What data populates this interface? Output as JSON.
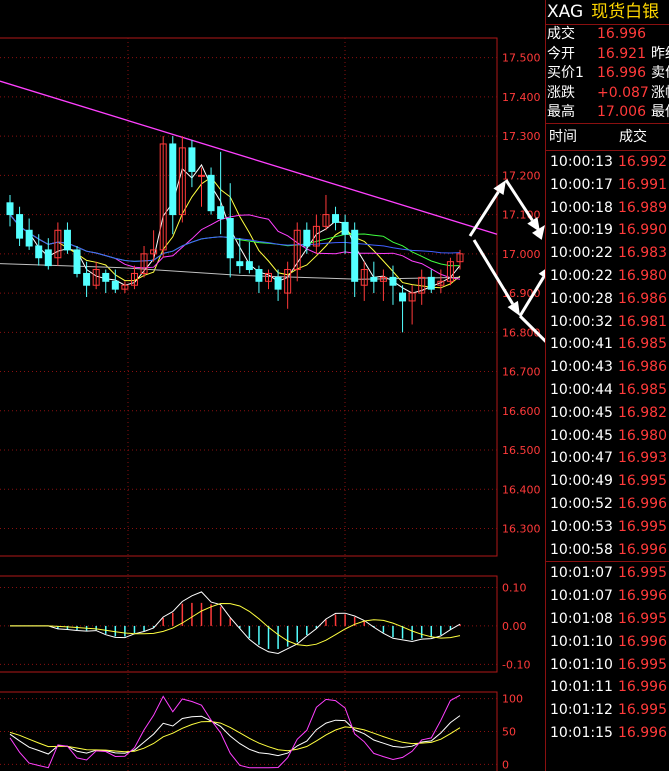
{
  "header": {
    "symbol": "XAG",
    "name": "现货白银"
  },
  "quotes": [
    {
      "label": "成交",
      "value": "16.996",
      "extra": ""
    },
    {
      "label": "今开",
      "value": "16.921",
      "extra": "昨结"
    },
    {
      "label": "买价1",
      "value": "16.996",
      "extra": "卖价"
    },
    {
      "label": "涨跌",
      "value": "+0.087",
      "extra": "涨幅"
    },
    {
      "label": "最高",
      "value": "17.006",
      "extra": "最低"
    }
  ],
  "trades_header": {
    "time": "时间",
    "price": "成交"
  },
  "trades": [
    {
      "time": "10:00:13",
      "price": "16.992"
    },
    {
      "time": "10:00:17",
      "price": "16.991"
    },
    {
      "time": "10:00:18",
      "price": "16.989"
    },
    {
      "time": "10:00:19",
      "price": "16.990"
    },
    {
      "time": "10:00:22",
      "price": "16.983"
    },
    {
      "time": "10:00:22",
      "price": "16.980"
    },
    {
      "time": "10:00:28",
      "price": "16.986"
    },
    {
      "time": "10:00:32",
      "price": "16.981"
    },
    {
      "time": "10:00:41",
      "price": "16.985"
    },
    {
      "time": "10:00:43",
      "price": "16.986"
    },
    {
      "time": "10:00:44",
      "price": "16.985"
    },
    {
      "time": "10:00:45",
      "price": "16.982"
    },
    {
      "time": "10:00:45",
      "price": "16.980"
    },
    {
      "time": "10:00:47",
      "price": "16.993"
    },
    {
      "time": "10:00:49",
      "price": "16.995"
    },
    {
      "time": "10:00:52",
      "price": "16.996"
    },
    {
      "time": "10:00:53",
      "price": "16.995"
    },
    {
      "time": "10:00:58",
      "price": "16.996"
    },
    {
      "time": "10:01:07",
      "price": "16.995"
    },
    {
      "time": "10:01:07",
      "price": "16.996"
    },
    {
      "time": "10:01:08",
      "price": "16.995"
    },
    {
      "time": "10:01:10",
      "price": "16.996"
    },
    {
      "time": "10:01:10",
      "price": "16.995"
    },
    {
      "time": "10:01:11",
      "price": "16.996"
    },
    {
      "time": "10:01:12",
      "price": "16.995"
    },
    {
      "time": "10:01:15",
      "price": "16.996"
    }
  ],
  "chart_data": {
    "type": "candlestick",
    "price_axis": {
      "ticks": [
        "17.500",
        "17.400",
        "17.300",
        "17.200",
        "17.100",
        "17.000",
        "16.900",
        "16.800",
        "16.700",
        "16.600",
        "16.500",
        "16.400",
        "16.300"
      ],
      "range": [
        16.23,
        17.55
      ]
    },
    "macd_axis": {
      "ticks": [
        "0.10",
        "0.00",
        "-0.10"
      ],
      "range": [
        -0.12,
        0.13
      ]
    },
    "kdj_axis": {
      "ticks": [
        "100",
        "50",
        "0"
      ],
      "range": [
        -10,
        110
      ]
    },
    "colors": {
      "up": "#ff3a3a",
      "down": "#54ffff",
      "ma5": "#ffffff",
      "ma10": "#ffff40",
      "ma20": "#ff40ff",
      "ma60": "#40ff40",
      "ma120": "#4060ff",
      "ma250": "#c0c0c0",
      "trend": "#ff40ff"
    },
    "candles": [
      {
        "o": 17.13,
        "h": 17.15,
        "l": 17.07,
        "c": 17.1
      },
      {
        "o": 17.1,
        "h": 17.12,
        "l": 17.02,
        "c": 17.04
      },
      {
        "o": 17.06,
        "h": 17.09,
        "l": 17.01,
        "c": 17.02
      },
      {
        "o": 17.02,
        "h": 17.05,
        "l": 16.97,
        "c": 16.99
      },
      {
        "o": 17.01,
        "h": 17.04,
        "l": 16.96,
        "c": 16.97
      },
      {
        "o": 16.99,
        "h": 17.08,
        "l": 16.97,
        "c": 17.06
      },
      {
        "o": 17.06,
        "h": 17.08,
        "l": 17.0,
        "c": 17.01
      },
      {
        "o": 17.01,
        "h": 17.02,
        "l": 16.94,
        "c": 16.95
      },
      {
        "o": 16.95,
        "h": 16.98,
        "l": 16.89,
        "c": 16.92
      },
      {
        "o": 16.92,
        "h": 16.98,
        "l": 16.91,
        "c": 16.96
      },
      {
        "o": 16.95,
        "h": 16.96,
        "l": 16.9,
        "c": 16.93
      },
      {
        "o": 16.93,
        "h": 16.96,
        "l": 16.9,
        "c": 16.91
      },
      {
        "o": 16.91,
        "h": 16.93,
        "l": 16.9,
        "c": 16.92
      },
      {
        "o": 16.92,
        "h": 16.97,
        "l": 16.91,
        "c": 16.95
      },
      {
        "o": 16.95,
        "h": 17.02,
        "l": 16.94,
        "c": 17.0
      },
      {
        "o": 17.0,
        "h": 17.06,
        "l": 16.98,
        "c": 17.01
      },
      {
        "o": 17.01,
        "h": 17.3,
        "l": 16.99,
        "c": 17.28
      },
      {
        "o": 17.28,
        "h": 17.3,
        "l": 17.05,
        "c": 17.1
      },
      {
        "o": 17.1,
        "h": 17.3,
        "l": 17.08,
        "c": 17.27
      },
      {
        "o": 17.27,
        "h": 17.29,
        "l": 17.17,
        "c": 17.21
      },
      {
        "o": 17.2,
        "h": 17.22,
        "l": 17.12,
        "c": 17.2
      },
      {
        "o": 17.2,
        "h": 17.22,
        "l": 17.1,
        "c": 17.11
      },
      {
        "o": 17.12,
        "h": 17.26,
        "l": 17.05,
        "c": 17.09
      },
      {
        "o": 17.09,
        "h": 17.18,
        "l": 16.94,
        "c": 16.99
      },
      {
        "o": 16.98,
        "h": 17.04,
        "l": 16.95,
        "c": 16.97
      },
      {
        "o": 16.98,
        "h": 17.03,
        "l": 16.95,
        "c": 16.96
      },
      {
        "o": 16.96,
        "h": 16.97,
        "l": 16.9,
        "c": 16.93
      },
      {
        "o": 16.93,
        "h": 16.96,
        "l": 16.91,
        "c": 16.95
      },
      {
        "o": 16.94,
        "h": 16.96,
        "l": 16.88,
        "c": 16.91
      },
      {
        "o": 16.9,
        "h": 16.98,
        "l": 16.86,
        "c": 16.96
      },
      {
        "o": 16.96,
        "h": 17.08,
        "l": 16.93,
        "c": 17.06
      },
      {
        "o": 17.06,
        "h": 17.08,
        "l": 17.0,
        "c": 17.02
      },
      {
        "o": 17.02,
        "h": 17.1,
        "l": 17.0,
        "c": 17.07
      },
      {
        "o": 17.07,
        "h": 17.15,
        "l": 17.06,
        "c": 17.1
      },
      {
        "o": 17.1,
        "h": 17.12,
        "l": 17.06,
        "c": 17.08
      },
      {
        "o": 17.08,
        "h": 17.1,
        "l": 17.0,
        "c": 17.05
      },
      {
        "o": 17.06,
        "h": 17.08,
        "l": 16.89,
        "c": 16.93
      },
      {
        "o": 16.92,
        "h": 16.98,
        "l": 16.88,
        "c": 16.96
      },
      {
        "o": 16.94,
        "h": 16.98,
        "l": 16.9,
        "c": 16.93
      },
      {
        "o": 16.93,
        "h": 16.96,
        "l": 16.88,
        "c": 16.94
      },
      {
        "o": 16.94,
        "h": 16.97,
        "l": 16.87,
        "c": 16.92
      },
      {
        "o": 16.9,
        "h": 16.92,
        "l": 16.8,
        "c": 16.88
      },
      {
        "o": 16.88,
        "h": 16.92,
        "l": 16.82,
        "c": 16.9
      },
      {
        "o": 16.9,
        "h": 16.96,
        "l": 16.87,
        "c": 16.94
      },
      {
        "o": 16.94,
        "h": 16.96,
        "l": 16.9,
        "c": 16.91
      },
      {
        "o": 16.92,
        "h": 16.96,
        "l": 16.9,
        "c": 16.93
      },
      {
        "o": 16.93,
        "h": 16.99,
        "l": 16.92,
        "c": 16.98
      },
      {
        "o": 16.98,
        "h": 17.01,
        "l": 16.96,
        "c": 17.0
      }
    ]
  }
}
